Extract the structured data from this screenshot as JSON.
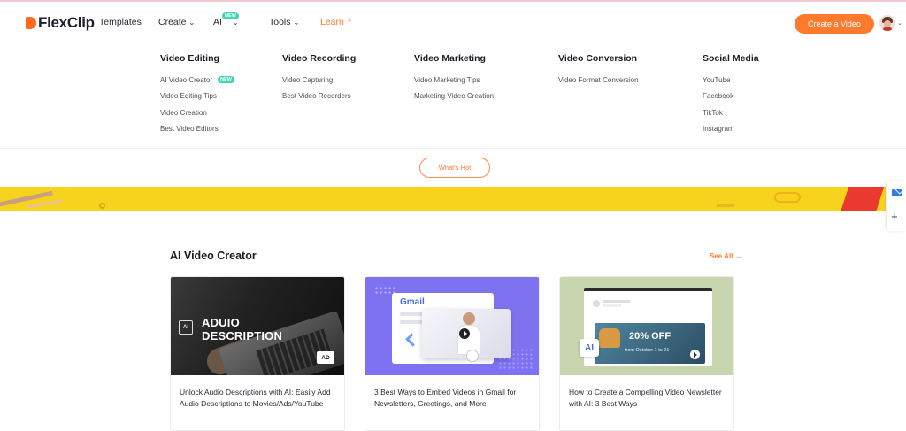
{
  "brand": {
    "name": "FlexClip",
    "accent": "#ff7a2d"
  },
  "nav": {
    "templates": "Templates",
    "create": "Create",
    "ai": "AI",
    "ai_badge": "NEW",
    "tools": "Tools",
    "learn": "Learn",
    "cta": "Create a Video"
  },
  "menu": {
    "columns": [
      {
        "heading": "Video Editing",
        "items": [
          "AI Video Creator",
          "Video Editing Tips",
          "Video Creation",
          "Best Video Editors"
        ],
        "badge": "NEW"
      },
      {
        "heading": "Video Recording",
        "items": [
          "Video Capturing",
          "Best Video Recorders"
        ]
      },
      {
        "heading": "Video Marketing",
        "items": [
          "Video Marketing Tips",
          "Marketing Video Creation"
        ]
      },
      {
        "heading": "Video Conversion",
        "items": [
          "Video Format Conversion"
        ]
      },
      {
        "heading": "Social Media",
        "items": [
          "YouTube",
          "Facebook",
          "TikTok",
          "Instagram"
        ]
      }
    ],
    "whats_hot": "What's Hot"
  },
  "section": {
    "title": "AI Video Creator",
    "see_all": "See All →"
  },
  "cards": [
    {
      "thumb_text": "ADUIO DESCRIPTION",
      "thumb_chip": "AI",
      "thumb_badge": "AD",
      "title": "Unlock Audio Descriptions with AI: Easily Add Audio Descriptions to Movies/Ads/YouTube"
    },
    {
      "thumb_text": "Gmail",
      "title": "3 Best Ways to Embed Videos in Gmail for Newsletters, Greetings, and More"
    },
    {
      "thumb_text": "20% OFF",
      "thumb_sub": "from October 1 to 21",
      "thumb_chip": "AI",
      "title": "How to Create a Compelling Video Newsletter with AI: 3 Best Ways"
    }
  ]
}
